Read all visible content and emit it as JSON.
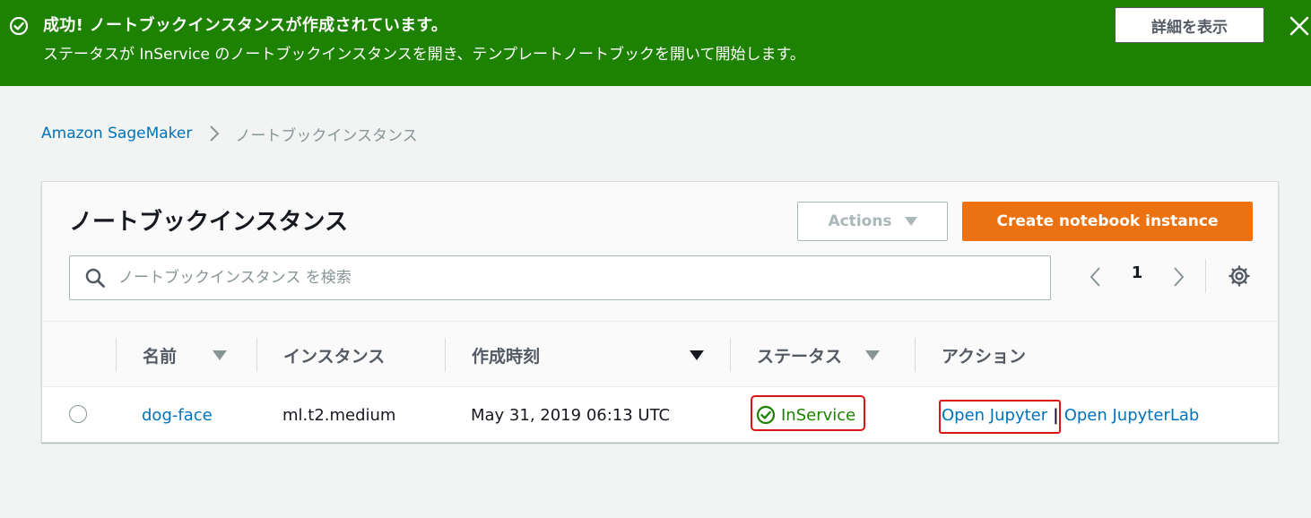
{
  "flash": {
    "title": "成功! ノートブックインスタンスが作成されています。",
    "message": "ステータスが InService のノートブックインスタンスを開き、テンプレートノートブックを開いて開始します。",
    "details_button": "詳細を表示",
    "color": "#1d8102"
  },
  "breadcrumb": {
    "root": "Amazon SageMaker",
    "current": "ノートブックインスタンス"
  },
  "panel": {
    "title": "ノートブックインスタンス",
    "actions_label": "Actions",
    "create_label": "Create notebook instance",
    "create_color": "#ec7211",
    "search_placeholder": "ノートブックインスタンス を検索",
    "search_value": "",
    "page": "1"
  },
  "table": {
    "columns": {
      "name": "名前",
      "instance": "インスタンス",
      "created": "作成時刻",
      "status": "ステータス",
      "actions": "アクション"
    },
    "rows": [
      {
        "name": "dog-face",
        "instance": "ml.t2.medium",
        "created": "May 31, 2019 06:13 UTC",
        "status": "InService",
        "action_jupyter": "Open Jupyter",
        "action_separator": "|",
        "action_jupyterlab": "Open JupyterLab"
      }
    ]
  }
}
